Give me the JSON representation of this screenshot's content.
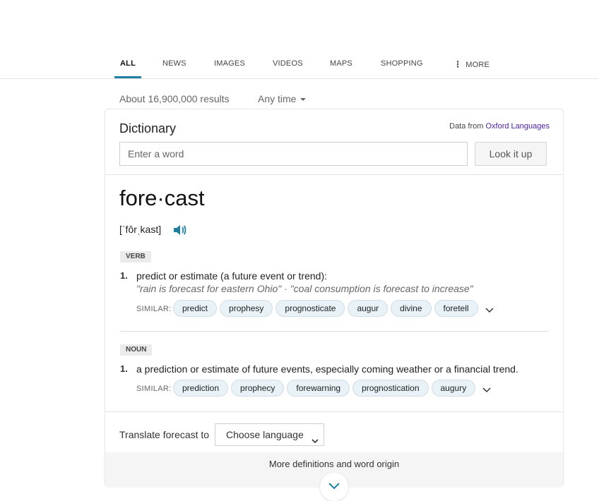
{
  "tabs": [
    {
      "label": "ALL",
      "active": true
    },
    {
      "label": "NEWS"
    },
    {
      "label": "IMAGES"
    },
    {
      "label": "VIDEOS"
    },
    {
      "label": "MAPS"
    },
    {
      "label": "SHOPPING"
    },
    {
      "label": "MORE",
      "icon": "vertical-dots-icon"
    }
  ],
  "results": {
    "count": "About 16,900,000 results",
    "time_filter": "Any time"
  },
  "dictionary": {
    "title": "Dictionary",
    "source_prefix": "Data from",
    "source_link": "Oxford Languages",
    "source_link_color": "#4b1a9e",
    "input_placeholder": "Enter a word",
    "lookup_label": "Look it up",
    "headword": "fore·cast",
    "pronunciation": "[ˈfôrˌkast]",
    "speaker_icon": "speaker-icon",
    "entries": [
      {
        "pos": "VERB",
        "number": "1.",
        "definition": "predict or estimate (a future event or trend):",
        "examples": "\"rain is forecast for eastern Ohio\" · \"coal consumption is forecast to increase\"",
        "similar_label": "SIMILAR:",
        "similar": [
          "predict",
          "prophesy",
          "prognosticate",
          "augur",
          "divine",
          "foretell"
        ]
      },
      {
        "pos": "NOUN",
        "number": "1.",
        "definition": "a prediction or estimate of future events, especially coming weather or a financial trend.",
        "similar_label": "SIMILAR:",
        "similar": [
          "prediction",
          "prophecy",
          "forewarning",
          "prognostication",
          "augury"
        ]
      }
    ],
    "translate_label": "Translate forecast to",
    "language_select": "Choose language",
    "more_link": "More definitions and word origin"
  },
  "colors": {
    "accent": "#1f7ea1",
    "chip_bg": "#e8f2f7"
  }
}
